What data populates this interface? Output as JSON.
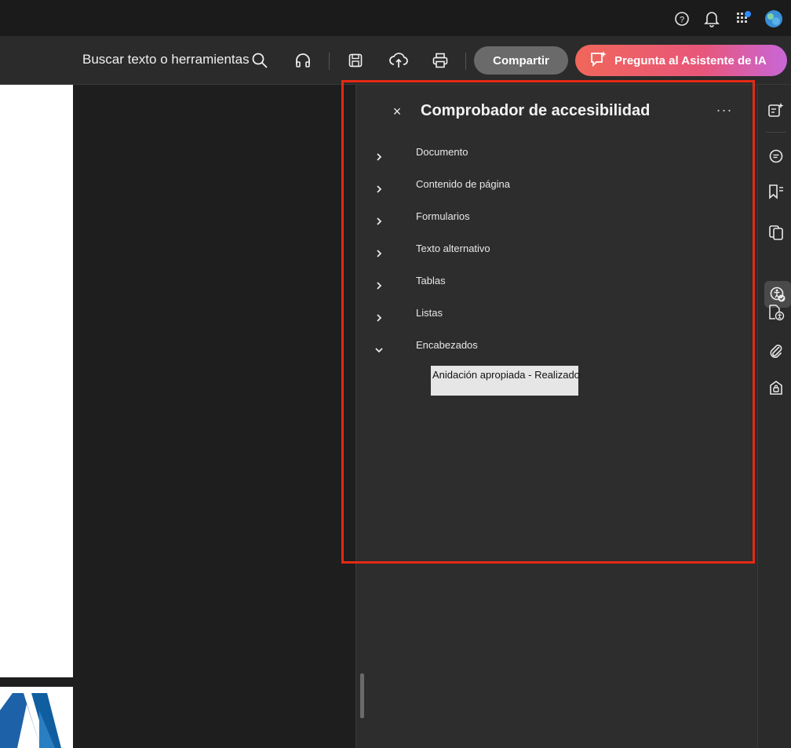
{
  "topbar": {
    "icons": [
      "help-icon",
      "bell-icon",
      "apps-icon",
      "avatar"
    ]
  },
  "toolbar": {
    "search_label": "Buscar texto o herramientas",
    "icons": [
      "search-icon",
      "read-aloud-icon",
      "save-icon",
      "upload-icon",
      "print-icon"
    ],
    "share_label": "Compartir",
    "ai_label": "Pregunta al Asistente de IA"
  },
  "panel": {
    "title": "Comprobador de accesibilidad",
    "close_symbol": "×",
    "more_symbol": "···",
    "items": [
      {
        "label": "Documento",
        "expanded": false
      },
      {
        "label": "Contenido de página",
        "expanded": false
      },
      {
        "label": "Formularios",
        "expanded": false
      },
      {
        "label": "Texto alternativo",
        "expanded": false
      },
      {
        "label": "Tablas",
        "expanded": false
      },
      {
        "label": "Listas",
        "expanded": false
      },
      {
        "label": "Encabezados",
        "expanded": true
      }
    ],
    "sub_item": "Anidación apropiada - Realizado"
  },
  "rail": {
    "icons": [
      "ai-assistant-icon",
      "comment-icon",
      "bookmark-icon",
      "pages-icon",
      "accessibility-icon",
      "accessibility-tags-icon",
      "attachment-icon",
      "security-icon"
    ],
    "active": "accessibility-icon"
  },
  "colors": {
    "highlight": "#e42a14",
    "ai_gradient_start": "#f0665a",
    "ai_gradient_end": "#c866d8",
    "panel_bg": "#2d2d2d"
  }
}
